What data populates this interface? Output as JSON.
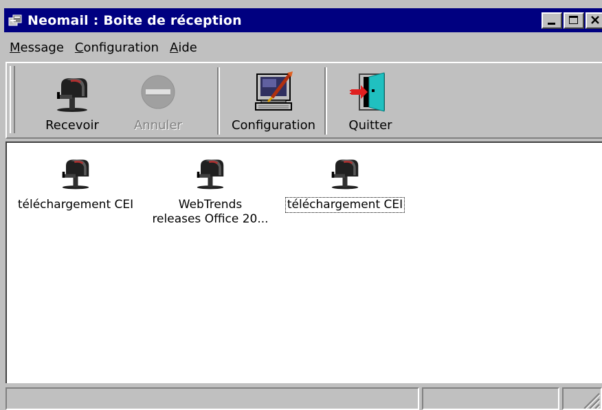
{
  "window": {
    "title": "Neomail : Boite de réception"
  },
  "menu": [
    {
      "accel": "M",
      "rest": "essage"
    },
    {
      "accel": "C",
      "rest": "onfiguration"
    },
    {
      "accel": "A",
      "rest": "ide"
    }
  ],
  "toolbar": {
    "receive_label": "Recevoir",
    "cancel_label": "Annuler",
    "config_label": "Configuration",
    "quit_label": "Quitter"
  },
  "mailboxes": [
    {
      "line1": "téléchargement CEI",
      "line2": "",
      "icon": "mailbox-icon"
    },
    {
      "line1": "WebTrends",
      "line2": "releases Office 20...",
      "icon": "mailbox-icon"
    },
    {
      "line1": "téléchargement CEI",
      "line2": "",
      "icon": "mailbox-icon"
    }
  ],
  "colors": {
    "titlebar": "#000080",
    "face": "#c0c0c0",
    "content_bg": "#ffffff"
  }
}
